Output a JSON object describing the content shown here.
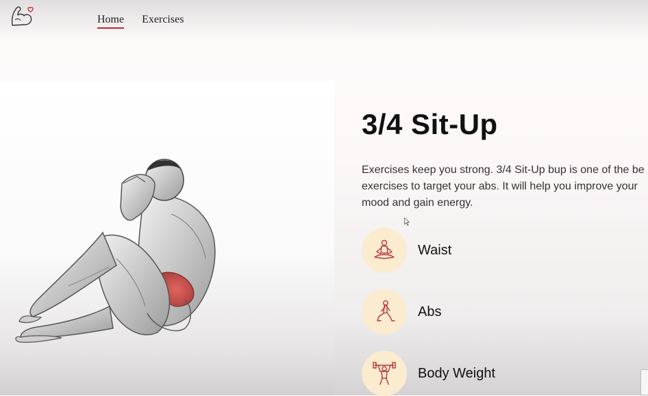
{
  "nav": {
    "logo": "flexed-arm-heart-icon",
    "links": [
      "Home",
      "Exercises"
    ],
    "active": "Home"
  },
  "exercise": {
    "image": "3/4 sit-up illustration",
    "title": "3/4 Sit-Up",
    "description_lines": [
      "Exercises keep you strong. 3/4 Sit-Up bup is one of the be",
      "exercises to target your abs. It will help you improve your",
      "mood and gain energy."
    ]
  },
  "details": [
    {
      "label": "Waist",
      "icon": "meditation-body-part-icon"
    },
    {
      "label": "Abs",
      "icon": "lunge-target-icon"
    },
    {
      "label": "Body Weight",
      "icon": "weightlifter-equipment-icon"
    }
  ],
  "colors": {
    "accent": "#c0262d",
    "icon_bg": "#fbeccf",
    "icon_stroke": "#b8343a"
  }
}
